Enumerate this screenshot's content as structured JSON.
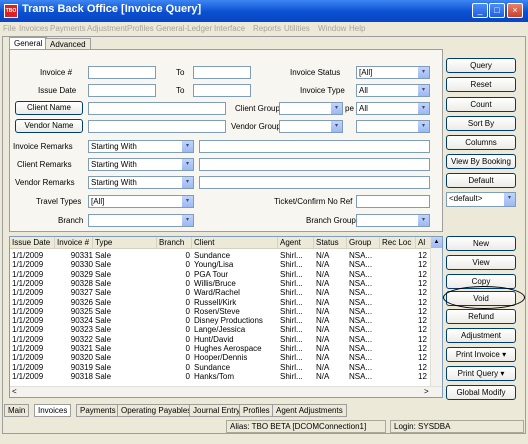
{
  "window": {
    "app_icon_text": "TBO",
    "title": "Trams Back Office [Invoice Query]",
    "minimize_symbol": "_",
    "maximize_symbol": "□",
    "close_symbol": "×"
  },
  "menu": [
    "File",
    "Invoices",
    "Payments",
    "Adjustment",
    "Profiles",
    "General-Ledger",
    "Interface",
    "Reports",
    "Utilities",
    "Window",
    "Help"
  ],
  "top_tabs": [
    "General",
    "Advanced"
  ],
  "form": {
    "invoice_num_label": "Invoice #",
    "to_label_1": "To",
    "issue_date_label": "Issue Date",
    "to_label_2": "To",
    "invoice_status_label": "Invoice Status",
    "invoice_status_value": "[All]",
    "invoice_type_label": "Invoice Type",
    "invoice_type_value": "All",
    "client_name_button": "Client Name",
    "client_group_label": "Client Group",
    "type_label_partial": "pe",
    "type_value": "All",
    "vendor_name_button": "Vendor Name",
    "vendor_group_label": "Vendor Group",
    "invoice_remarks_label": "Invoice Remarks",
    "invoice_remarks_mode": "Starting With",
    "client_remarks_label": "Client Remarks",
    "client_remarks_mode": "Starting With",
    "vendor_remarks_label": "Vendor Remarks",
    "vendor_remarks_mode": "Starting With",
    "travel_types_label": "Travel Types",
    "travel_types_value": "[All]",
    "ticket_confirm_label": "Ticket/Confirm No Ref",
    "branch_label": "Branch",
    "branch_group_label": "Branch Group"
  },
  "right_buttons": {
    "query": "Query",
    "reset": "Reset",
    "count": "Count",
    "sort_by": "Sort By",
    "columns": "Columns",
    "view_by_booking": "View By Booking",
    "default": "Default",
    "default_select": "<default>",
    "new": "New",
    "view": "View",
    "copy": "Copy",
    "void": "Void",
    "refund": "Refund",
    "adjustment": "Adjustment",
    "print_invoice": "Print Invoice",
    "print_query": "Print Query",
    "global_modify": "Global Modify"
  },
  "grid": {
    "columns": [
      "Issue Date",
      "Invoice #",
      "Type",
      "Branch",
      "Client",
      "Agent",
      "Status",
      "Group",
      "Rec Loc",
      "Al"
    ],
    "rows": [
      [
        "1/1/2009",
        "90331",
        "Sale",
        "0",
        "Sundance",
        "Shirl...",
        "N/A",
        "NSA...",
        "",
        "12"
      ],
      [
        "1/1/2009",
        "90330",
        "Sale",
        "0",
        "Young/Lisa",
        "Shirl...",
        "N/A",
        "NSA...",
        "",
        "12"
      ],
      [
        "1/1/2009",
        "90329",
        "Sale",
        "0",
        "PGA Tour",
        "Shirl...",
        "N/A",
        "NSA...",
        "",
        "12"
      ],
      [
        "1/1/2009",
        "90328",
        "Sale",
        "0",
        "Willis/Bruce",
        "Shirl...",
        "N/A",
        "NSA...",
        "",
        "12"
      ],
      [
        "1/1/2009",
        "90327",
        "Sale",
        "0",
        "Ward/Rachel",
        "Shirl...",
        "N/A",
        "NSA...",
        "",
        "12"
      ],
      [
        "1/1/2009",
        "90326",
        "Sale",
        "0",
        "Russell/Kirk",
        "Shirl...",
        "N/A",
        "NSA...",
        "",
        "12"
      ],
      [
        "1/1/2009",
        "90325",
        "Sale",
        "0",
        "Rosen/Steve",
        "Shirl...",
        "N/A",
        "NSA...",
        "",
        "12"
      ],
      [
        "1/1/2009",
        "90324",
        "Sale",
        "0",
        "Disney Productions",
        "Shirl...",
        "N/A",
        "NSA...",
        "",
        "12"
      ],
      [
        "1/1/2009",
        "90323",
        "Sale",
        "0",
        "Lange/Jessica",
        "Shirl...",
        "N/A",
        "NSA...",
        "",
        "12"
      ],
      [
        "1/1/2009",
        "90322",
        "Sale",
        "0",
        "Hunt/David",
        "Shirl...",
        "N/A",
        "NSA...",
        "",
        "12"
      ],
      [
        "1/1/2009",
        "90321",
        "Sale",
        "0",
        "Hughes Aerospace",
        "Shirl...",
        "N/A",
        "NSA...",
        "",
        "12"
      ],
      [
        "1/1/2009",
        "90320",
        "Sale",
        "0",
        "Hooper/Dennis",
        "Shirl...",
        "N/A",
        "NSA...",
        "",
        "12"
      ],
      [
        "1/1/2009",
        "90319",
        "Sale",
        "0",
        "Sundance",
        "Shirl...",
        "N/A",
        "NSA...",
        "",
        "12"
      ],
      [
        "1/1/2009",
        "90318",
        "Sale",
        "0",
        "Hanks/Tom",
        "Shirl...",
        "N/A",
        "NSA...",
        "",
        "12"
      ]
    ]
  },
  "bottom_tabs": [
    "Main",
    "Invoices",
    "Payments",
    "Operating Payables",
    "Journal Entry",
    "Profiles",
    "Agent Adjustments"
  ],
  "status": {
    "alias": "Alias: TBO BETA [DCOMConnection1]",
    "login": "Login: SYSDBA"
  },
  "icons": {
    "dropdown": "▾",
    "scroll_up": "▲",
    "scroll_left": "<",
    "scroll_right": ">"
  }
}
